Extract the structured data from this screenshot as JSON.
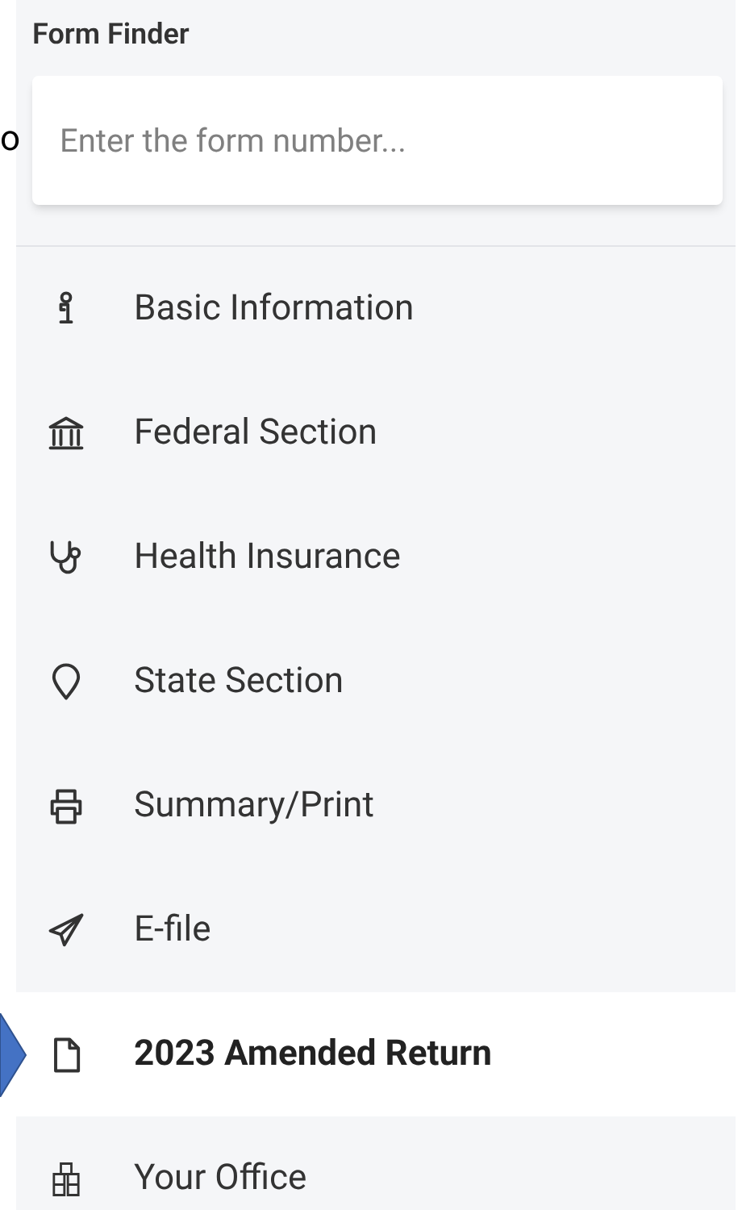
{
  "edge_text": "o",
  "title": "Form Finder",
  "search": {
    "placeholder": "Enter the form number..."
  },
  "menu": [
    {
      "label": "Basic Information",
      "selected": false
    },
    {
      "label": "Federal Section",
      "selected": false
    },
    {
      "label": "Health Insurance",
      "selected": false
    },
    {
      "label": "State Section",
      "selected": false
    },
    {
      "label": "Summary/Print",
      "selected": false
    },
    {
      "label": "E-file",
      "selected": false
    },
    {
      "label": "2023 Amended Return",
      "selected": true
    },
    {
      "label": "Your Office",
      "selected": false
    }
  ]
}
